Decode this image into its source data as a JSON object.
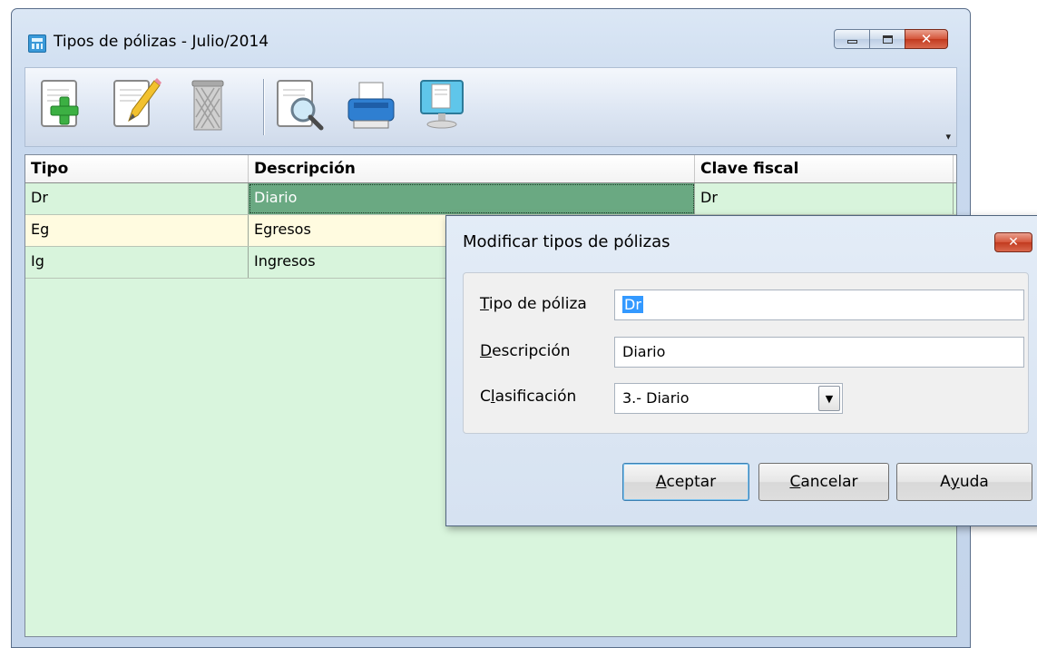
{
  "window": {
    "title": "Tipos de pólizas - Julio/2014",
    "icon": "calculator-icon"
  },
  "toolbar": {
    "buttons": [
      {
        "name": "new-document-icon"
      },
      {
        "name": "edit-document-icon"
      },
      {
        "name": "delete-trash-icon"
      },
      {
        "name": "preview-document-icon"
      },
      {
        "name": "printer-icon"
      },
      {
        "name": "screen-display-icon"
      }
    ],
    "more": "▾"
  },
  "table": {
    "columns": [
      "Tipo",
      "Descripción",
      "Clave fiscal"
    ],
    "rows": [
      {
        "tipo": "Dr",
        "descripcion": "Diario",
        "clave": "Dr"
      },
      {
        "tipo": "Eg",
        "descripcion": "Egresos",
        "clave": ""
      },
      {
        "tipo": "Ig",
        "descripcion": "Ingresos",
        "clave": ""
      }
    ]
  },
  "dialog": {
    "title": "Modificar tipos de pólizas",
    "close": "x",
    "fields": {
      "tipo_label_accel": "T",
      "tipo_label_rest": "ipo de póliza",
      "tipo_value": "Dr",
      "desc_label_accel": "D",
      "desc_label_rest": "escripción",
      "desc_value": "Diario",
      "clas_label_pre": "C",
      "clas_label_accel": "l",
      "clas_label_rest": "asificación",
      "clas_value": "3.- Diario"
    },
    "buttons": {
      "accept_accel": "A",
      "accept_rest": "ceptar",
      "cancel_accel": "C",
      "cancel_rest": "ancelar",
      "help_pre": "A",
      "help_accel": "y",
      "help_rest": "uda"
    }
  },
  "colors": {
    "grid_bg": "#d9f5dd",
    "row_alt": "#fffbe0",
    "selected_cell": "#6aa982",
    "selection_highlight": "#3399ff"
  }
}
